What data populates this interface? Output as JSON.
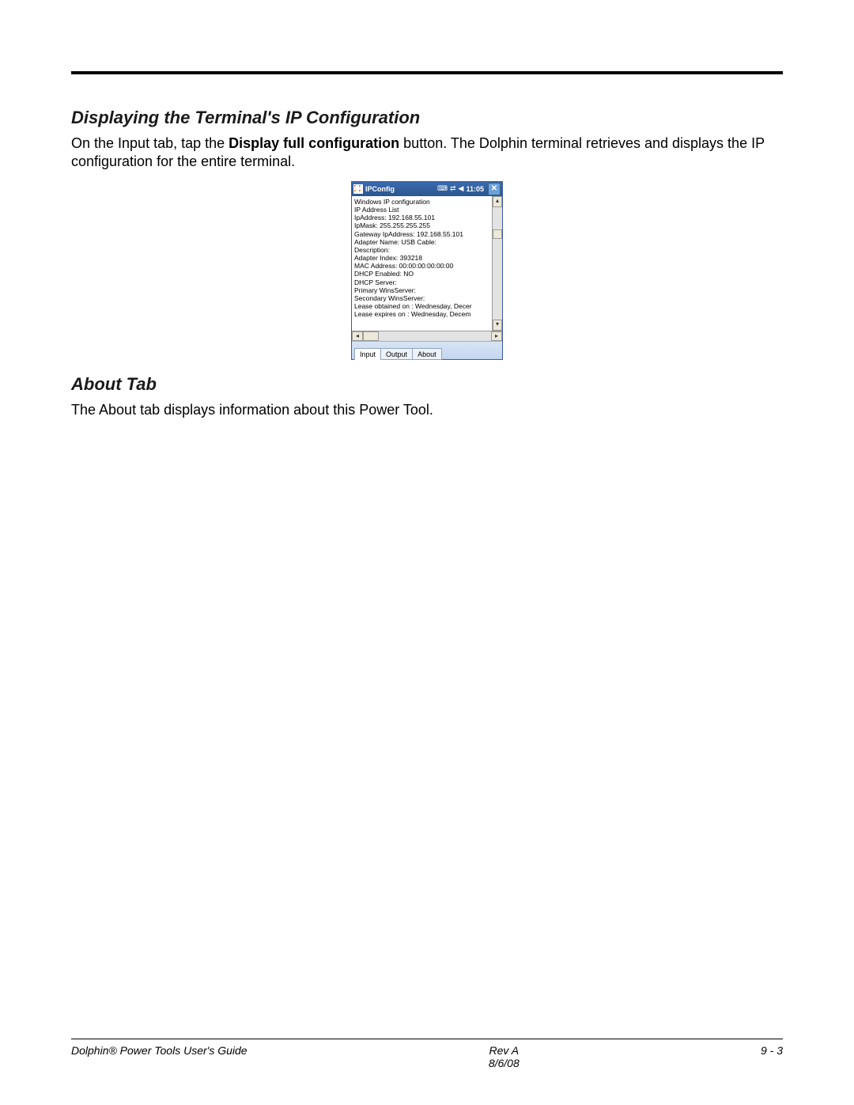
{
  "headings": {
    "h1": "Displaying the Terminal's IP Configuration",
    "h2": "About Tab"
  },
  "paragraphs": {
    "p1_pre": "On the Input tab, tap the ",
    "p1_bold": "Display full configuration",
    "p1_post": " button. The Dolphin terminal retrieves and displays the IP configuration for the entire terminal.",
    "p2": "The About tab displays information about this Power Tool."
  },
  "screenshot": {
    "title": "IPConfig",
    "time": "11:05",
    "close_glyph": "✕",
    "up_glyph": "▴",
    "down_glyph": "▾",
    "left_glyph": "◂",
    "right_glyph": "▸",
    "lines": [
      "Windows IP configuration",
      "IP Address List",
      "IpAddress: 192.168.55.101",
      "IpMask: 255.255.255.255",
      "Gateway IpAddress: 192.168.55.101",
      "Adapter Name: USB Cable:",
      "Description:",
      "Adapter Index: 393218",
      "MAC Address: 00:00:00:00:00:00",
      "DHCP Enabled: NO",
      "DHCP Server:",
      "Primary WinsServer:",
      "Secondary WinsServer:",
      "Lease obtained on : Wednesday, Decer",
      "Lease expires on  : Wednesday, Decem"
    ],
    "tabs": {
      "input": "Input",
      "output": "Output",
      "about": "About"
    }
  },
  "status_icons": {
    "kbd": "⌨",
    "net": "⇄",
    "vol": "◀"
  },
  "footer": {
    "left": "Dolphin® Power Tools User's Guide",
    "center_top": "Rev A",
    "center_bottom": "8/6/08",
    "right": "9 - 3"
  }
}
